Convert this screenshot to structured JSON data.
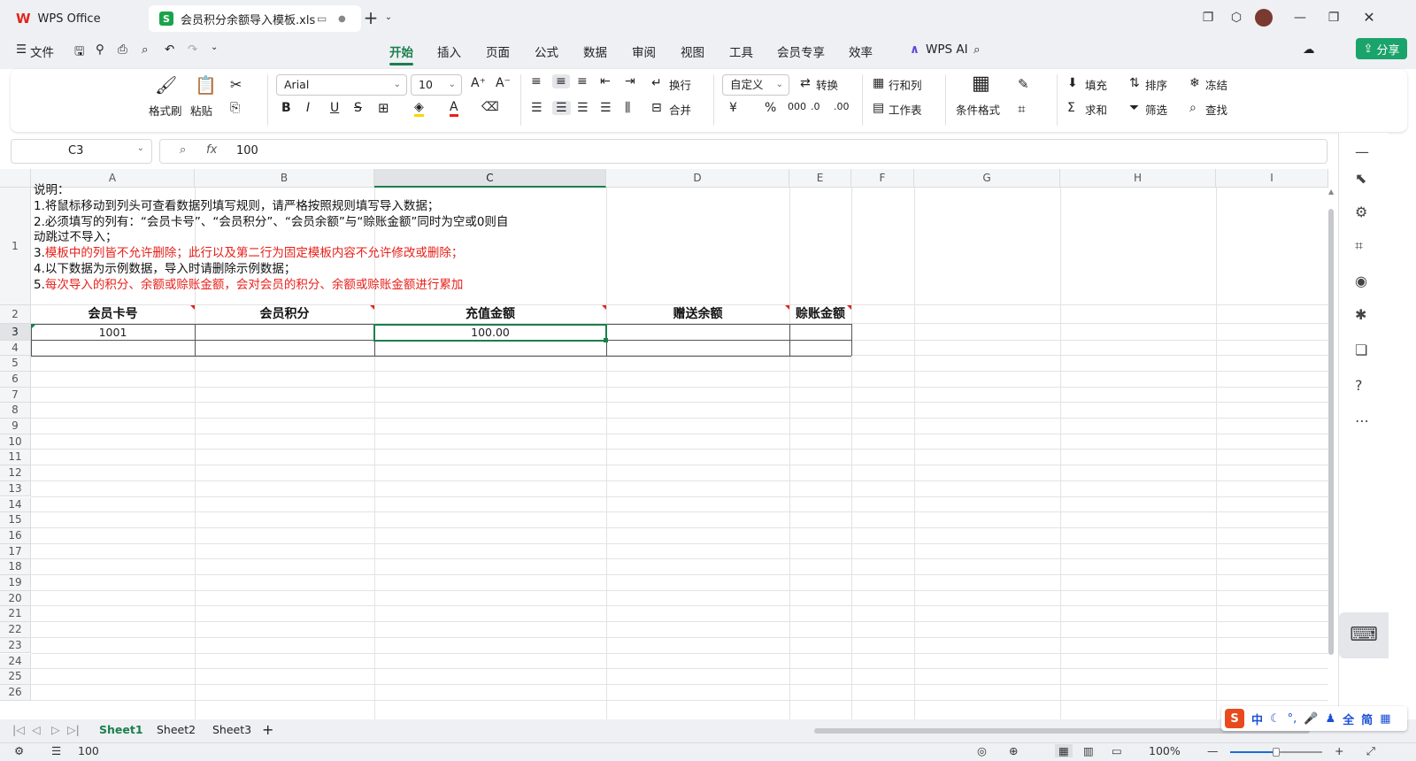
{
  "titlebar": {
    "home_tab": "WPS Office",
    "doc_tab": "会员积分余额导入模板.xls",
    "new_tab": "+"
  },
  "menu": {
    "file": "文件",
    "items": [
      "开始",
      "插入",
      "页面",
      "公式",
      "数据",
      "审阅",
      "视图",
      "工具",
      "会员专享",
      "效率"
    ],
    "wps_ai": "WPS AI",
    "share": "分享"
  },
  "ribbon": {
    "format_painter": "格式刷",
    "paste": "粘贴",
    "font": "Arial",
    "font_size": "10",
    "wrap": "换行",
    "merge": "合并",
    "number_format": "自定义",
    "convert": "转换",
    "rows_cols": "行和列",
    "worksheet": "工作表",
    "cond_format": "条件格式",
    "fill": "填充",
    "sort": "排序",
    "freeze": "冻结",
    "sum": "求和",
    "filter": "筛选",
    "find": "查找",
    "bold": "B",
    "italic": "I",
    "underline": "U",
    "strike": "S",
    "percent": "%"
  },
  "formula_bar": {
    "cell_ref": "C3",
    "fx": "fx",
    "value": "100"
  },
  "grid": {
    "columns": [
      "A",
      "B",
      "C",
      "D",
      "E",
      "F",
      "G",
      "H",
      "I"
    ],
    "rows": [
      "1",
      "2",
      "3",
      "4",
      "5",
      "6",
      "7",
      "8",
      "9",
      "10",
      "11",
      "12",
      "13",
      "14",
      "15",
      "16",
      "17",
      "18",
      "19",
      "20",
      "21",
      "22",
      "23",
      "24",
      "25",
      "26"
    ],
    "note_lines": [
      "说明：",
      "1.将鼠标移动到列头可查看数据列填写规则，请严格按照规则填写导入数据；",
      "2.必须填写的列有：“会员卡号”、“会员积分”、“会员余额”与“赊账金额”同时为空或0则自",
      "动跳过不导入；",
      "3.",
      "模板中的列皆不允许删除；此行以及第二行为固定模板内容不允许修改或删除；",
      "4.以下数据为示例数据，导入时请删除示例数据；",
      "5.",
      "每次导入的积分、余额或赊账金额，会对会员的积分、余额或赊账金额进行累加"
    ],
    "headers": [
      "会员卡号",
      "会员积分",
      "充值金额",
      "赠送余额",
      "赊账金额"
    ],
    "row3": [
      "1001",
      "",
      "100.00",
      "",
      ""
    ]
  },
  "sheets": {
    "tabs": [
      "Sheet1",
      "Sheet2",
      "Sheet3"
    ],
    "add": "+"
  },
  "status": {
    "value": "100",
    "zoom": "100%"
  },
  "ime": {
    "items": [
      "中",
      "全",
      "简"
    ]
  },
  "colors": {
    "accent": "#1a7f4b",
    "red": "#e8201a"
  }
}
